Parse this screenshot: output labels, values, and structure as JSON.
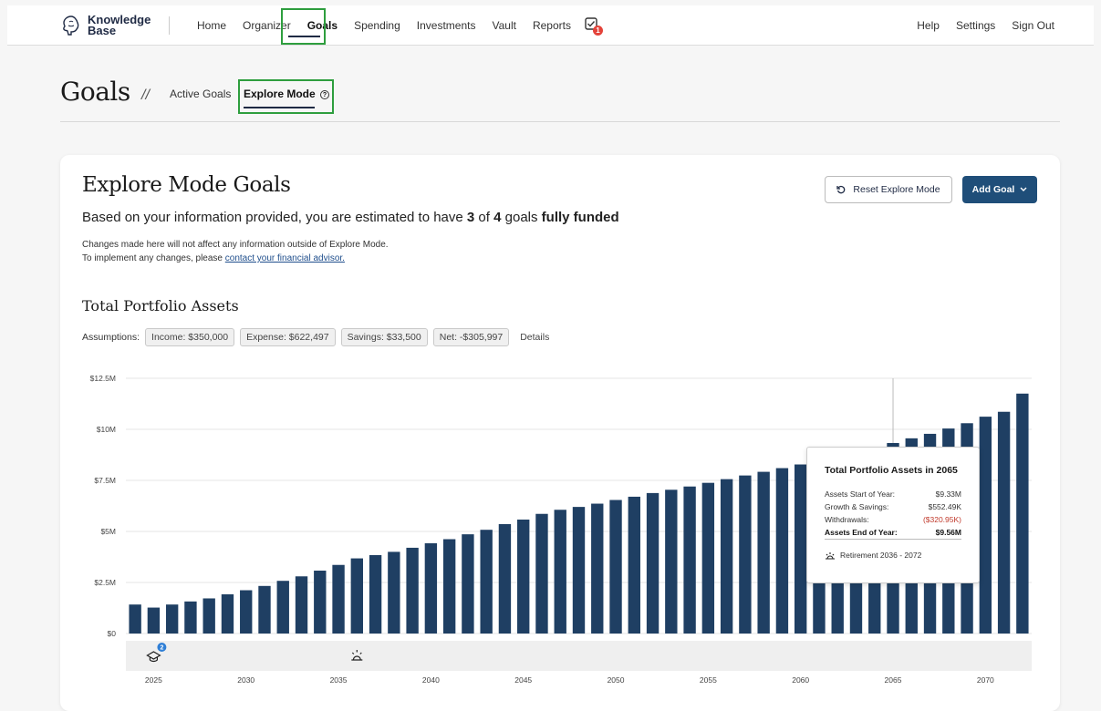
{
  "nav": {
    "logo_line1": "Knowledge",
    "logo_line2": "Base",
    "links": [
      "Home",
      "Organizer",
      "Goals",
      "Spending",
      "Investments",
      "Vault",
      "Reports"
    ],
    "active": "Goals",
    "task_badge": "1",
    "right_links": [
      "Help",
      "Settings",
      "Sign Out"
    ]
  },
  "header": {
    "title": "Goals",
    "separator": "//",
    "tabs": [
      "Active Goals",
      "Explore Mode"
    ],
    "active_tab": "Explore Mode"
  },
  "card": {
    "title": "Explore Mode Goals",
    "subtitle_pre": "Based on your information provided, you are estimated to have ",
    "funded_count": "3",
    "subtitle_mid": " of ",
    "total_count": "4",
    "subtitle_post": " goals ",
    "subtitle_bold": "fully funded",
    "note_line1": "Changes made here will not affect any information outside of Explore Mode.",
    "note_line2_pre": "To implement any changes, please ",
    "note_link": "contact your financial advisor.",
    "reset_label": "Reset Explore Mode",
    "add_label": "Add Goal"
  },
  "section": {
    "title": "Total Portfolio Assets",
    "assumptions_label": "Assumptions:",
    "chips": [
      "Income: $350,000",
      "Expense: $622,497",
      "Savings: $33,500",
      "Net: -$305,997"
    ],
    "details_label": "Details"
  },
  "tooltip": {
    "title": "Total Portfolio Assets in 2065",
    "rows": [
      {
        "label": "Assets Start of Year:",
        "value": "$9.33M"
      },
      {
        "label": "Growth & Savings:",
        "value": "$552.49K"
      },
      {
        "label": "Withdrawals:",
        "value": "($320.95K)"
      },
      {
        "label": "Assets End of Year:",
        "value": "$9.56M"
      }
    ],
    "footer": "Retirement 2036 - 2072"
  },
  "colors": {
    "bar": "#1f3f63",
    "accent": "#1f4e79",
    "highlight_box": "#2e9e3e",
    "negative": "#c0392b"
  },
  "chart_data": {
    "type": "bar",
    "title": "Total Portfolio Assets",
    "x": [
      2024,
      2025,
      2026,
      2027,
      2028,
      2029,
      2030,
      2031,
      2032,
      2033,
      2034,
      2035,
      2036,
      2037,
      2038,
      2039,
      2040,
      2041,
      2042,
      2043,
      2044,
      2045,
      2046,
      2047,
      2048,
      2049,
      2050,
      2051,
      2052,
      2053,
      2054,
      2055,
      2056,
      2057,
      2058,
      2059,
      2060,
      2061,
      2062,
      2063,
      2064,
      2065,
      2066,
      2067,
      2068,
      2069,
      2070,
      2071,
      2072
    ],
    "values": [
      1.42,
      1.27,
      1.42,
      1.57,
      1.72,
      1.92,
      2.12,
      2.33,
      2.58,
      2.8,
      3.08,
      3.36,
      3.68,
      3.84,
      4.0,
      4.2,
      4.42,
      4.62,
      4.86,
      5.08,
      5.36,
      5.58,
      5.86,
      6.06,
      6.2,
      6.36,
      6.54,
      6.7,
      6.88,
      7.04,
      7.2,
      7.38,
      7.56,
      7.74,
      7.92,
      8.1,
      8.28,
      8.46,
      8.66,
      8.86,
      9.04,
      9.33,
      9.56,
      9.78,
      10.04,
      10.3,
      10.62,
      10.86,
      11.75
    ],
    "y_unit": "$M",
    "ylim": [
      0,
      12.5
    ],
    "y_ticks": [
      "$0",
      "$2.5M",
      "$5M",
      "$7.5M",
      "$10M",
      "$12.5M"
    ],
    "x_ticks": [
      "2025",
      "2030",
      "2035",
      "2040",
      "2045",
      "2050",
      "2055",
      "2060",
      "2065",
      "2070"
    ],
    "markers": [
      {
        "year": 2025,
        "icon": "graduation-cap-icon",
        "badge": "2"
      },
      {
        "year": 2036,
        "icon": "sunrise-icon"
      }
    ],
    "hover_year": 2065,
    "grid": true
  }
}
